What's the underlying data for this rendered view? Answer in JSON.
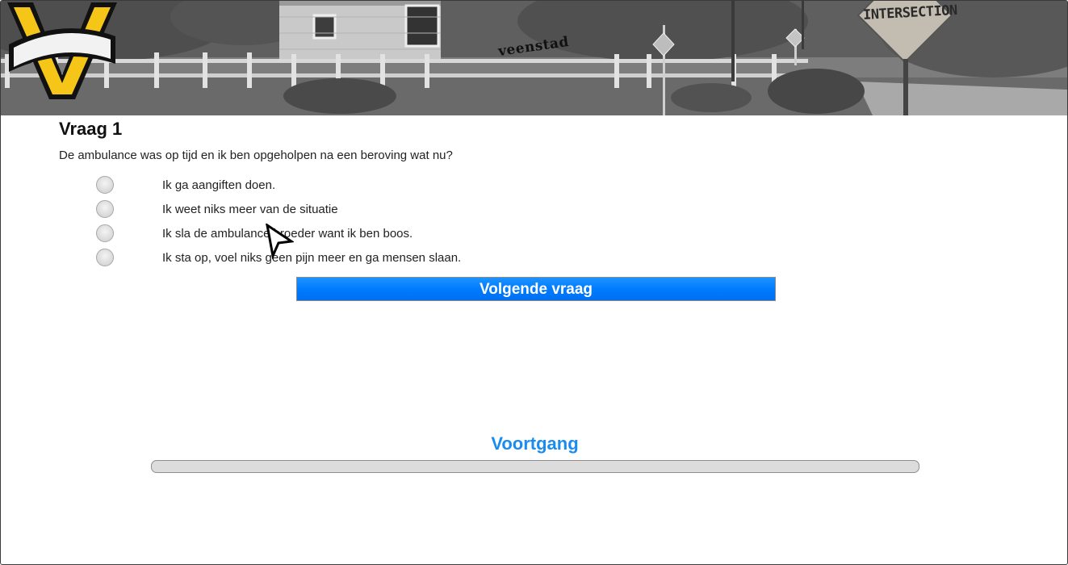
{
  "banner": {
    "logo_text": "veenstad",
    "sign_text": "INTERSECTION",
    "logo_icon": "veenstad-v-logo"
  },
  "question": {
    "title": "Vraag 1",
    "text": "De ambulance was op tijd en ik ben opgeholpen na een beroving wat nu?",
    "answers": [
      {
        "label": "Ik ga aangiften doen."
      },
      {
        "label": "Ik weet niks meer van de situatie"
      },
      {
        "label": "Ik sla de ambulance broeder want ik ben boos."
      },
      {
        "label": "Ik sta op, voel niks geen pijn meer en ga mensen slaan."
      }
    ],
    "next_label": "Volgende vraag"
  },
  "progress": {
    "title": "Voortgang",
    "fraction": 0,
    "accent": "#1a8cf0"
  },
  "colors": {
    "button": "#007bff",
    "progress_track": "#dcdcdc"
  }
}
